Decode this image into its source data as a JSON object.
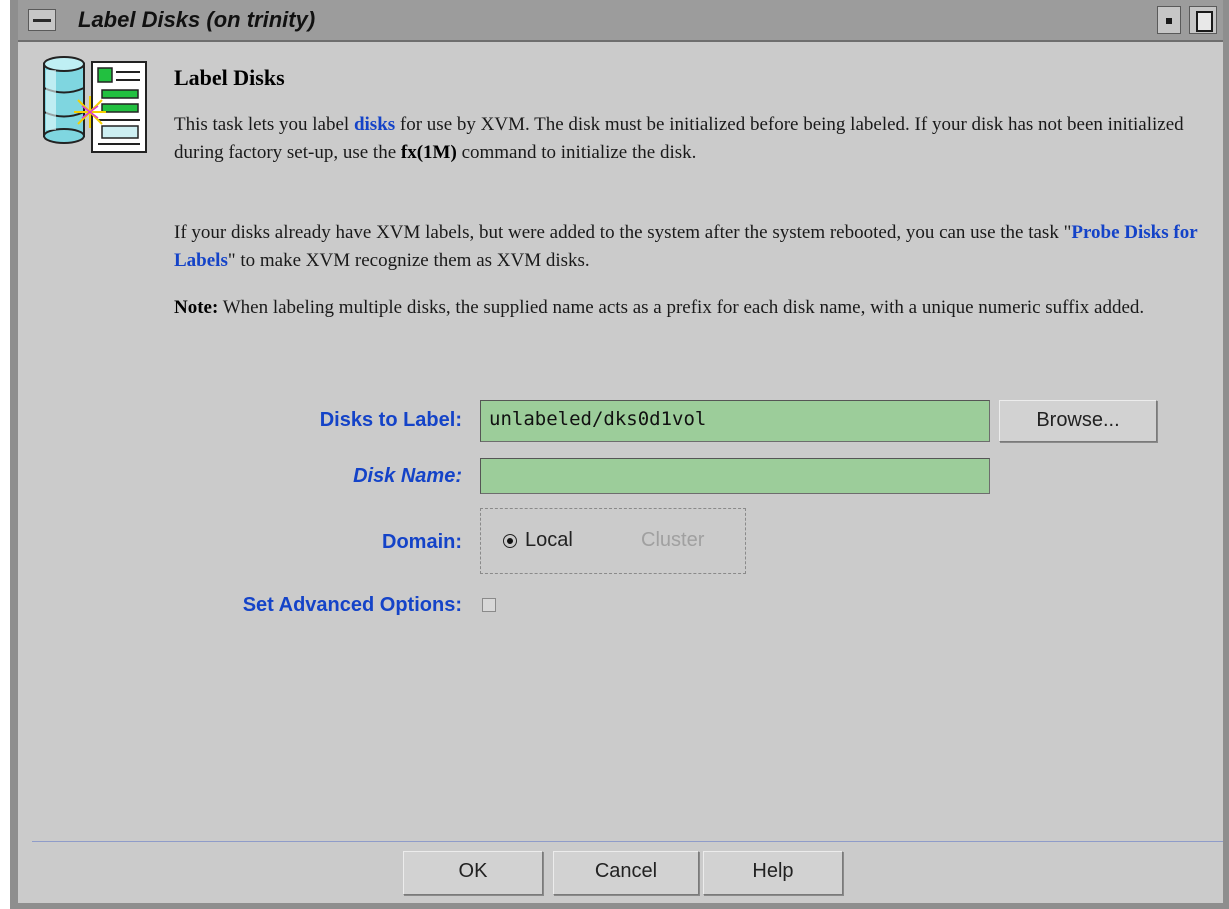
{
  "window": {
    "title": "Label Disks (on trinity)"
  },
  "header": {
    "heading": "Label Disks"
  },
  "description": {
    "p1_a": "This task lets you label ",
    "p1_link": "disks",
    "p1_b": " for use by XVM.  The disk must be initialized before being labeled. If your disk has not been initialized during factory set-up, use the ",
    "p1_cmd": "fx(1M)",
    "p1_c": " command to initialize the disk.",
    "p2_a": "If your disks already have XVM labels, but were added to the system after the system rebooted, you can use the task \"",
    "p2_link": "Probe Disks for Labels",
    "p2_b": "\" to make XVM recognize them as XVM disks.",
    "p3_note": "Note:",
    "p3_text": " When labeling multiple disks, the supplied name acts as a prefix for each disk name, with a unique numeric suffix added."
  },
  "form": {
    "disks_label": "Disks to Label:",
    "disks_value": "unlabeled/dks0d1vol",
    "browse_label": "Browse...",
    "name_label": "Disk Name:",
    "name_value": "",
    "domain_label": "Domain:",
    "domain_options": [
      "Local",
      "Cluster"
    ],
    "domain_selected": "Local",
    "advanced_label": "Set Advanced Options:",
    "advanced_checked": false
  },
  "footer": {
    "ok_label": "OK",
    "cancel_label": "Cancel",
    "help_label": "Help"
  },
  "colors": {
    "link": "#1443c8",
    "field_bg": "#9ccd9a",
    "window_bg": "#cbcbcb"
  }
}
